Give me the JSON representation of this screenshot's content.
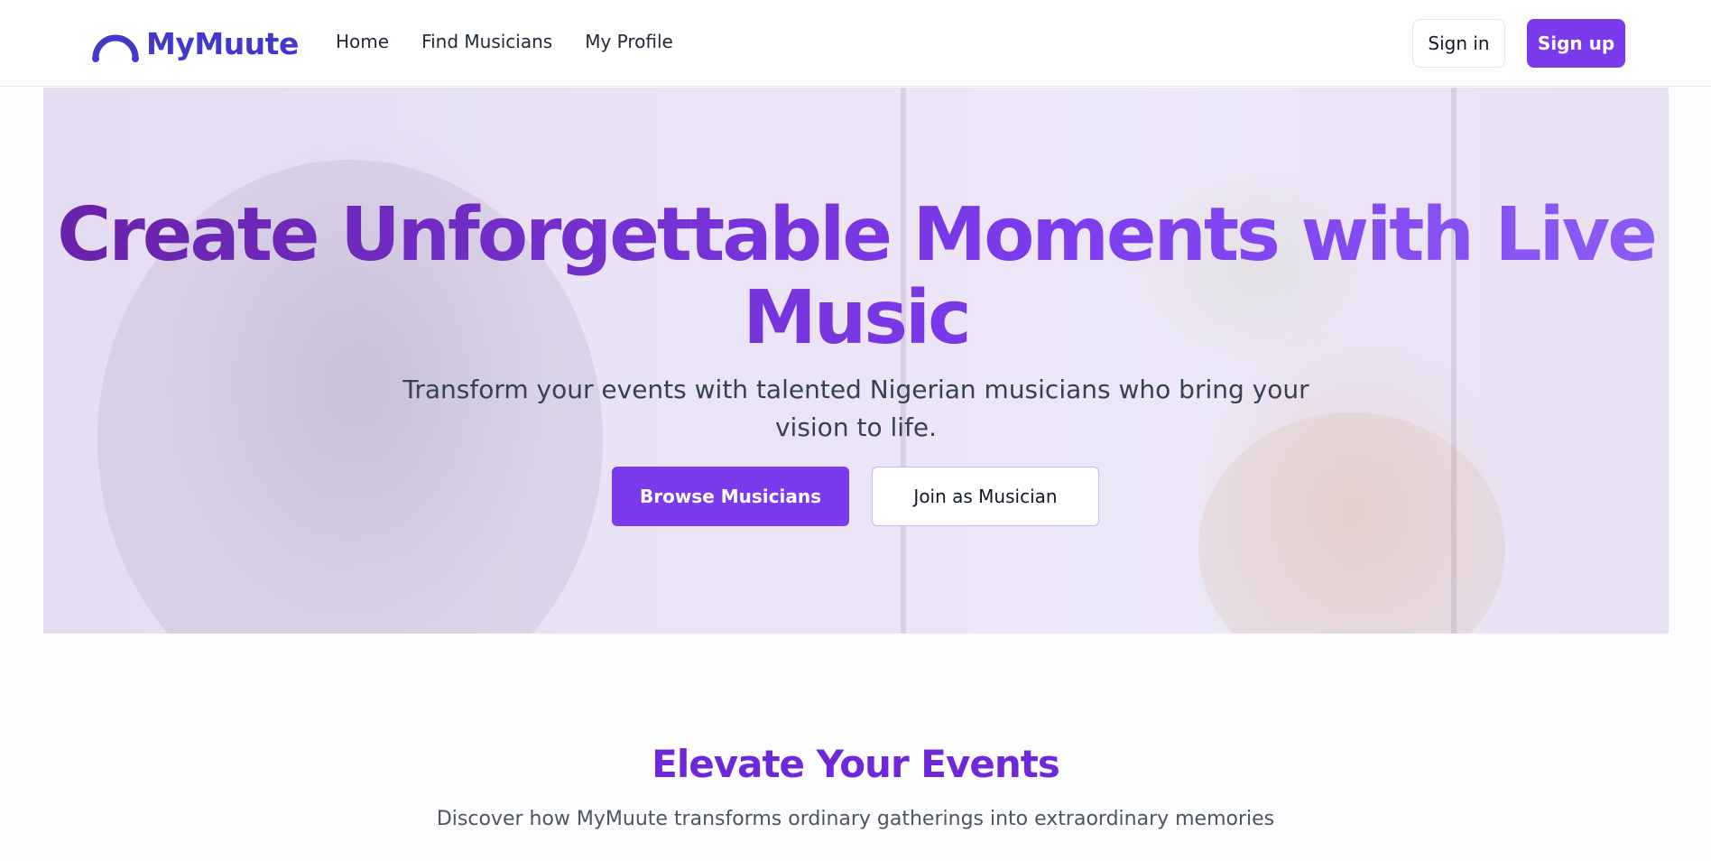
{
  "brand": {
    "name": "MyMuute",
    "logo_icon": "headphones-arc-icon",
    "color": "#4338ca"
  },
  "nav": {
    "links": [
      "Home",
      "Find Musicians",
      "My Profile"
    ],
    "signin_label": "Sign in",
    "signup_label": "Sign up"
  },
  "hero": {
    "title": "Create Unforgettable Moments with Live Music",
    "subtitle": "Transform your events with talented Nigerian musicians who bring your vision to life.",
    "primary_button": "Browse Musicians",
    "secondary_button": "Join as Musician",
    "background_image": "musician-playing-cello-photo"
  },
  "section": {
    "title": "Elevate Your Events",
    "subtitle": "Discover how MyMuute transforms ordinary gatherings into extraordinary memories"
  },
  "colors": {
    "accent": "#7c3aed",
    "title_gradient_start": "#6b21a8",
    "title_gradient_end": "#8b5cf6"
  }
}
